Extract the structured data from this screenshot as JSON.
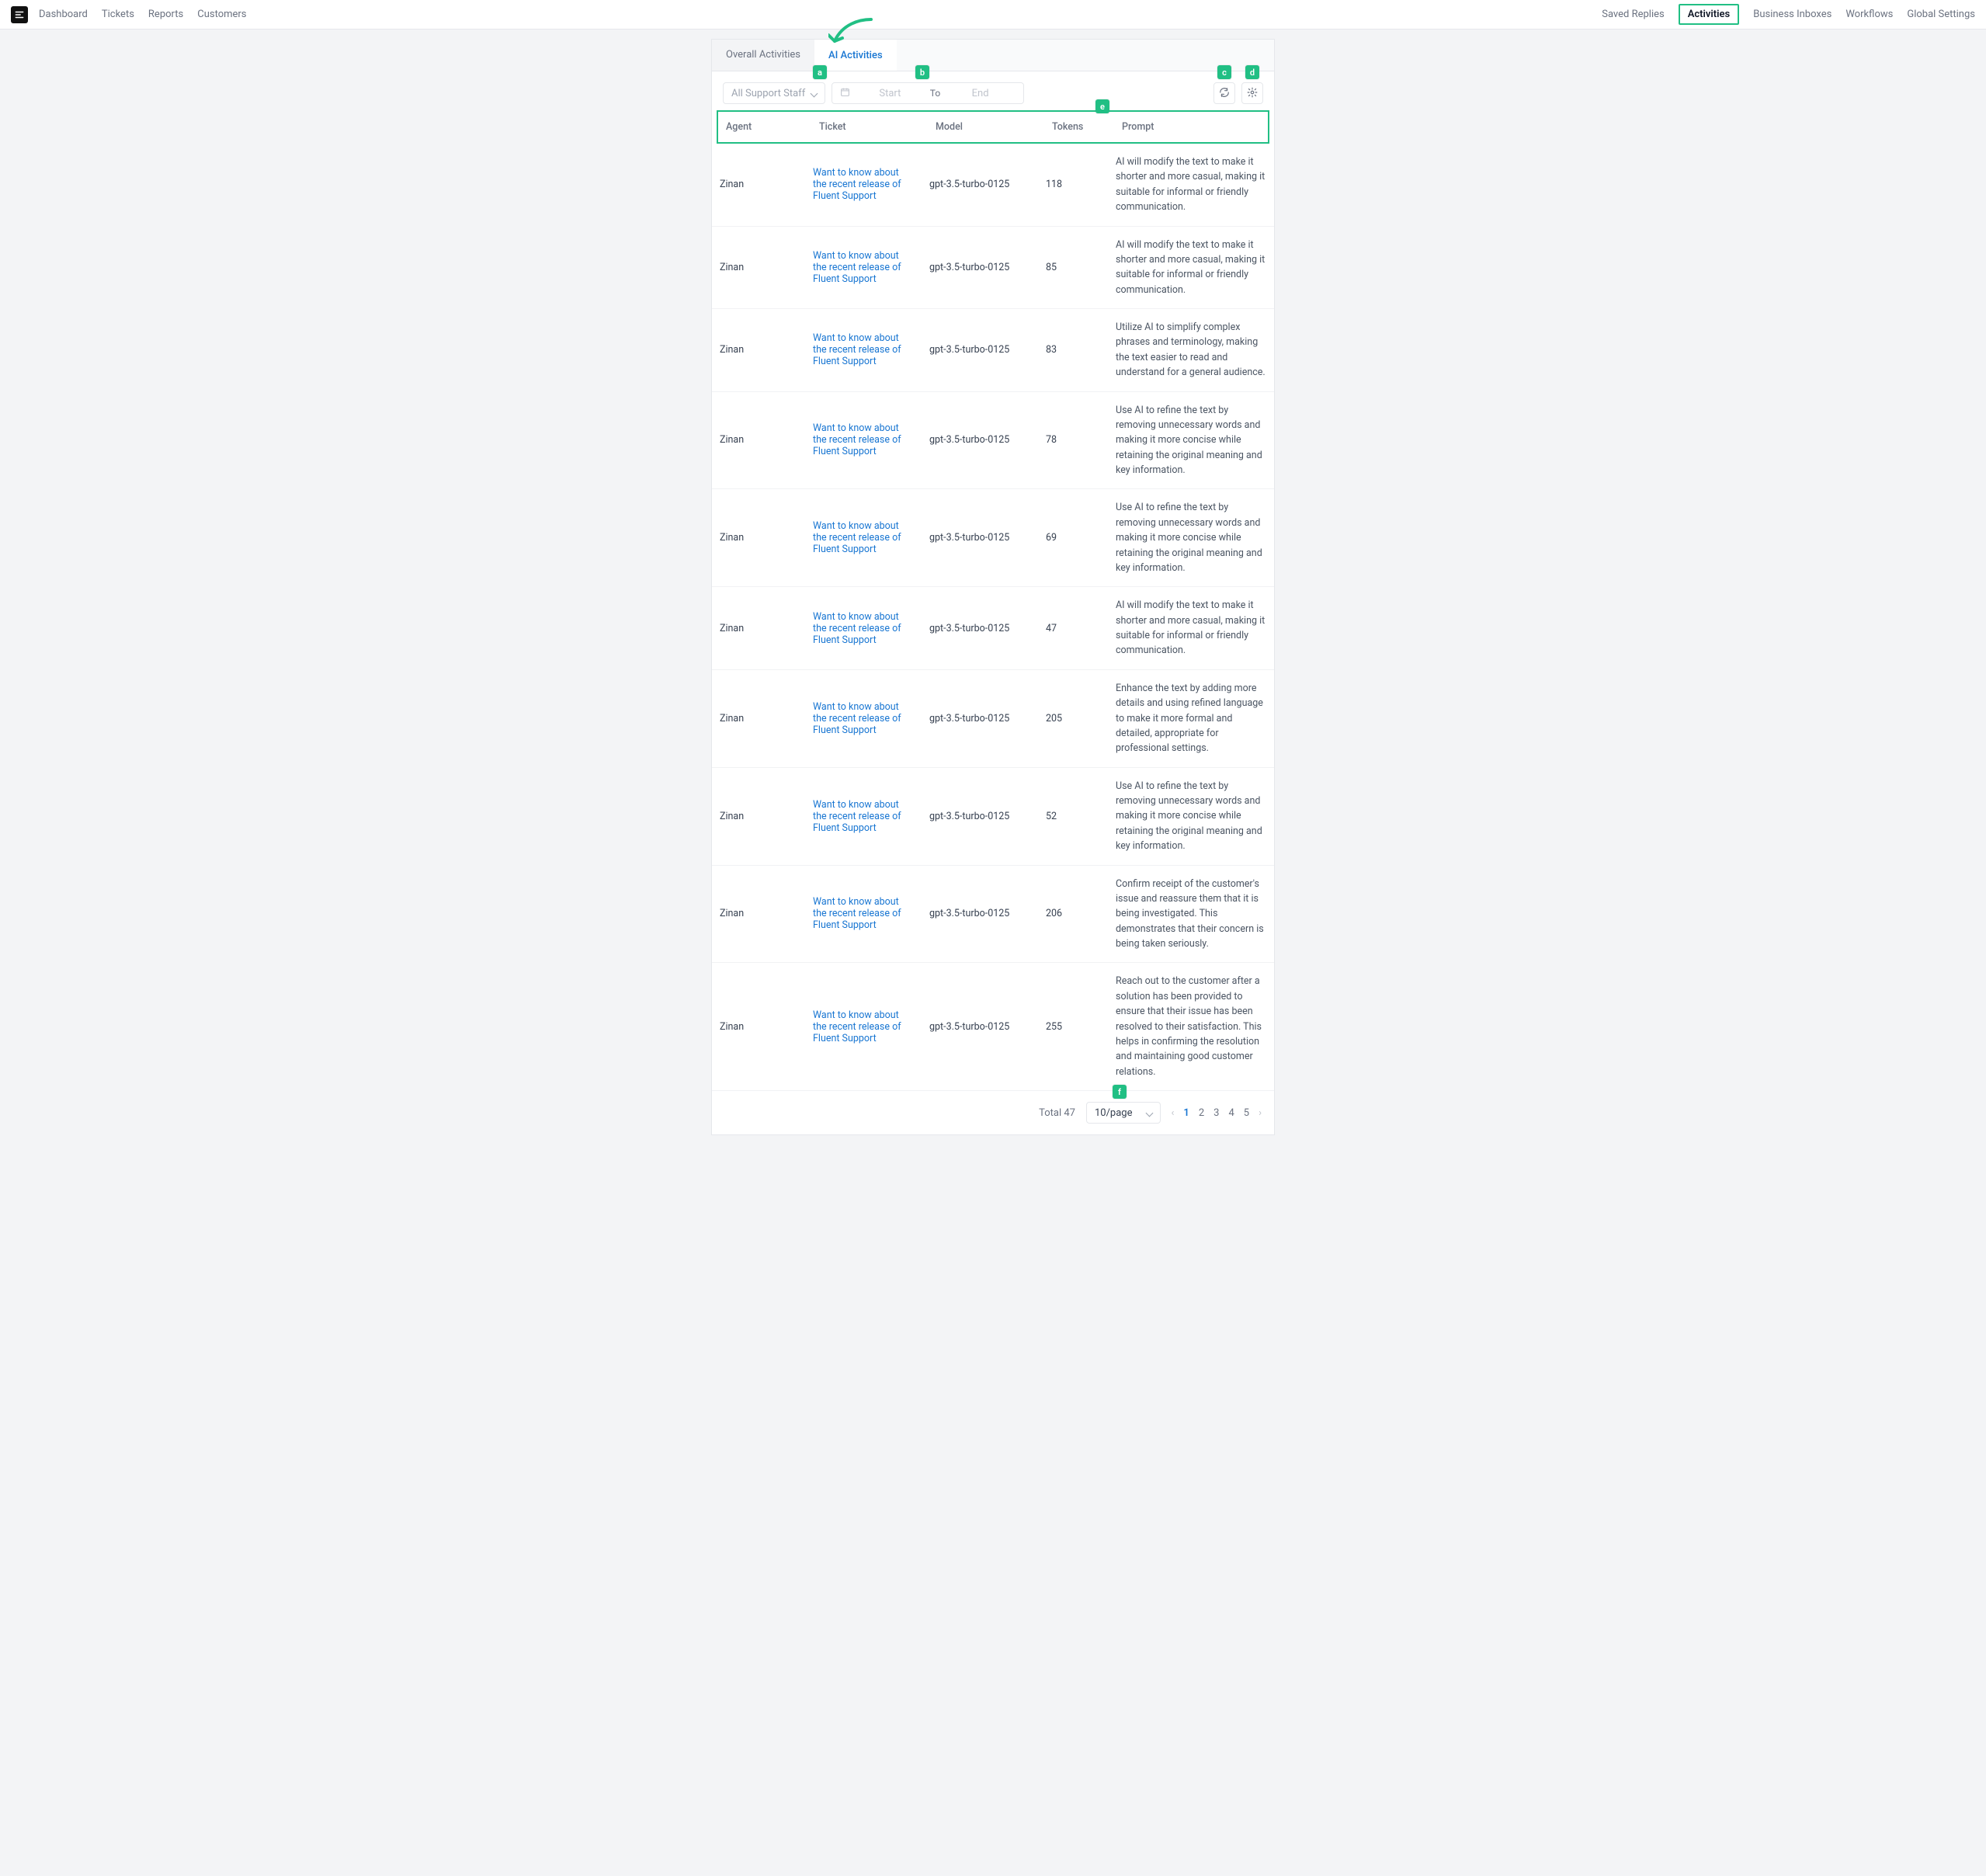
{
  "nav": {
    "left": [
      "Dashboard",
      "Tickets",
      "Reports",
      "Customers"
    ],
    "right": [
      "Saved Replies",
      "Activities",
      "Business Inboxes",
      "Workflows",
      "Global Settings"
    ],
    "highlight": "Activities"
  },
  "tabs": {
    "items": [
      "Overall Activities",
      "AI Activities"
    ],
    "active": "AI Activities"
  },
  "filters": {
    "staff_select_placeholder": "All Support Staff",
    "date_start_placeholder": "Start",
    "date_to_label": "To",
    "date_end_placeholder": "End"
  },
  "table": {
    "columns": [
      "Agent",
      "Ticket",
      "Model",
      "Tokens",
      "Prompt"
    ],
    "rows": [
      {
        "agent": "Zinan",
        "ticket": "Want to know about the recent release of Fluent Support",
        "model": "gpt-3.5-turbo-0125",
        "tokens": "118",
        "prompt": "AI will modify the text to make it shorter and more casual, making it suitable for informal or friendly communication."
      },
      {
        "agent": "Zinan",
        "ticket": "Want to know about the recent release of Fluent Support",
        "model": "gpt-3.5-turbo-0125",
        "tokens": "85",
        "prompt": "AI will modify the text to make it shorter and more casual, making it suitable for informal or friendly communication."
      },
      {
        "agent": "Zinan",
        "ticket": "Want to know about the recent release of Fluent Support",
        "model": "gpt-3.5-turbo-0125",
        "tokens": "83",
        "prompt": "Utilize AI to simplify complex phrases and terminology, making the text easier to read and understand for a general audience."
      },
      {
        "agent": "Zinan",
        "ticket": "Want to know about the recent release of Fluent Support",
        "model": "gpt-3.5-turbo-0125",
        "tokens": "78",
        "prompt": "Use AI to refine the text by removing unnecessary words and making it more concise while retaining the original meaning and key information."
      },
      {
        "agent": "Zinan",
        "ticket": "Want to know about the recent release of Fluent Support",
        "model": "gpt-3.5-turbo-0125",
        "tokens": "69",
        "prompt": "Use AI to refine the text by removing unnecessary words and making it more concise while retaining the original meaning and key information."
      },
      {
        "agent": "Zinan",
        "ticket": "Want to know about the recent release of Fluent Support",
        "model": "gpt-3.5-turbo-0125",
        "tokens": "47",
        "prompt": "AI will modify the text to make it shorter and more casual, making it suitable for informal or friendly communication."
      },
      {
        "agent": "Zinan",
        "ticket": "Want to know about the recent release of Fluent Support",
        "model": "gpt-3.5-turbo-0125",
        "tokens": "205",
        "prompt": "Enhance the text by adding more details and using refined language to make it more formal and detailed, appropriate for professional settings."
      },
      {
        "agent": "Zinan",
        "ticket": "Want to know about the recent release of Fluent Support",
        "model": "gpt-3.5-turbo-0125",
        "tokens": "52",
        "prompt": "Use AI to refine the text by removing unnecessary words and making it more concise while retaining the original meaning and key information."
      },
      {
        "agent": "Zinan",
        "ticket": "Want to know about the recent release of Fluent Support",
        "model": "gpt-3.5-turbo-0125",
        "tokens": "206",
        "prompt": "Confirm receipt of the customer's issue and reassure them that it is being investigated. This demonstrates that their concern is being taken seriously."
      },
      {
        "agent": "Zinan",
        "ticket": "Want to know about the recent release of Fluent Support",
        "model": "gpt-3.5-turbo-0125",
        "tokens": "255",
        "prompt": "Reach out to the customer after a solution has been provided to ensure that their issue has been resolved to their satisfaction. This helps in confirming the resolution and maintaining good customer relations."
      }
    ]
  },
  "footer": {
    "total_label": "Total 47",
    "page_size": "10/page",
    "pages": [
      "1",
      "2",
      "3",
      "4",
      "5"
    ],
    "active_page": "1"
  },
  "badges": {
    "a": "a",
    "b": "b",
    "c": "c",
    "d": "d",
    "e": "e",
    "f": "f"
  }
}
